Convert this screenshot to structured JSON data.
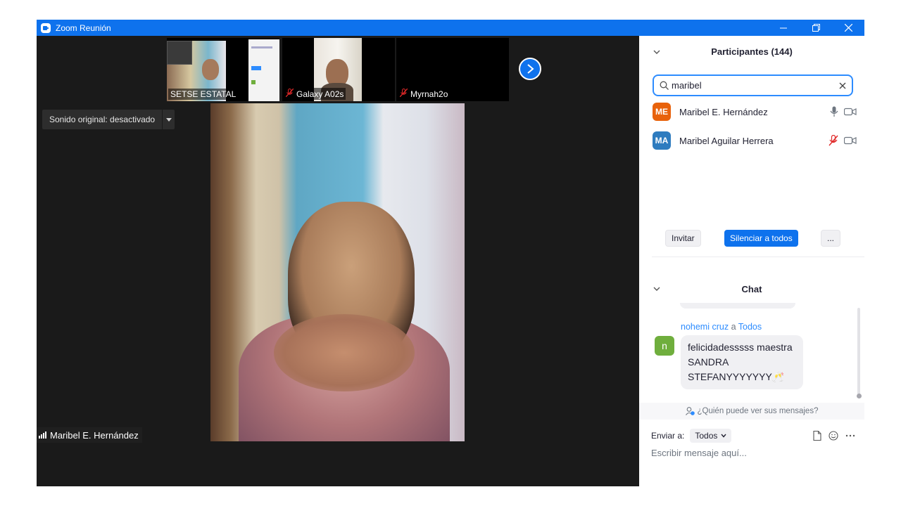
{
  "window": {
    "title": "Zoom Reunión"
  },
  "thumbnails": [
    {
      "label": "SETSE ESTATAL",
      "muted": false
    },
    {
      "label": "Galaxy A02s",
      "muted": true
    },
    {
      "label": "Myrnah2o",
      "muted": true
    }
  ],
  "video": {
    "sound_label": "Sonido original: desactivado",
    "active_speaker": "Maribel E. Hernández"
  },
  "participants": {
    "title": "Participantes (144)",
    "search_value": "maribel",
    "list": [
      {
        "initials": "ME",
        "name": "Maribel E. Hernández",
        "color": "#e8620b",
        "mic": "on"
      },
      {
        "initials": "MA",
        "name": "Maribel Aguilar Herrera",
        "color": "#2e7cbf",
        "mic": "muted"
      }
    ],
    "actions": {
      "invite": "Invitar",
      "mute_all": "Silenciar a todos",
      "more": "..."
    }
  },
  "chat": {
    "title": "Chat",
    "message": {
      "sender": "nohemi cruz",
      "to_word": "a",
      "recipient": "Todos",
      "avatar": "n",
      "lines": [
        "felicidadesssss maestra",
        "SANDRA",
        "STEFANYYYYYYY🥂"
      ]
    },
    "who_can_see": "¿Quién puede ver sus mensajes?",
    "send_to_label": "Enviar a:",
    "send_to_value": "Todos",
    "input_placeholder": "Escribir mensaje aquí..."
  },
  "colors": {
    "accent": "#0e72ed",
    "muted_red": "#e02828"
  }
}
